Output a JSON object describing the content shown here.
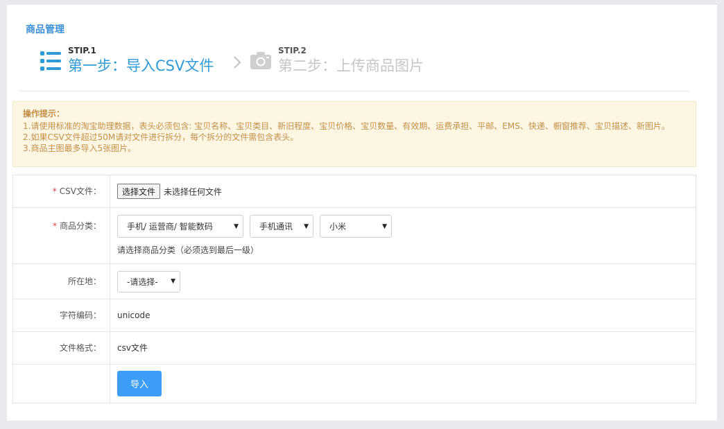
{
  "breadcrumb": "商品管理",
  "steps": [
    {
      "tag": "STIP.1",
      "title": "第一步：导入CSV文件",
      "icon": "list-icon",
      "color": "#2f9bd6"
    },
    {
      "tag": "STIP.2",
      "title": "第二步：上传商品图片",
      "icon": "camera-icon",
      "color": "#c6c6c6"
    }
  ],
  "tips": {
    "title": "操作提示：",
    "lines": [
      "1.请使用标准的淘宝助理数据，表头必须包含: 宝贝名称、宝贝类目、新旧程度、宝贝价格、宝贝数量、有效期、运费承担、平邮、EMS、快递、橱窗推荐、宝贝描述、新图片。",
      "2.如果CSV文件超过50M请对文件进行拆分，每个拆分的文件需包含表头。",
      "3.商品主图最多导入5张图片。"
    ]
  },
  "form": {
    "required_mark": "*",
    "csv": {
      "label": "CSV文件：",
      "button": "选择文件",
      "status": "未选择任何文件"
    },
    "category": {
      "label": "商品分类：",
      "selects": [
        "手机/ 运营商/ 智能数码",
        "手机通讯",
        "小米"
      ],
      "hint": "请选择商品分类（必须选到最后一级）"
    },
    "location": {
      "label": "所在地：",
      "select": "-请选择-"
    },
    "encoding": {
      "label": "字符编码：",
      "value": "unicode"
    },
    "format": {
      "label": "文件格式：",
      "value": "csv文件"
    },
    "submit": "导入"
  },
  "colors": {
    "accent": "#3b9df5",
    "tip_text": "#c2904a",
    "tip_bg": "#fdf6e3",
    "required": "#e4393c"
  }
}
